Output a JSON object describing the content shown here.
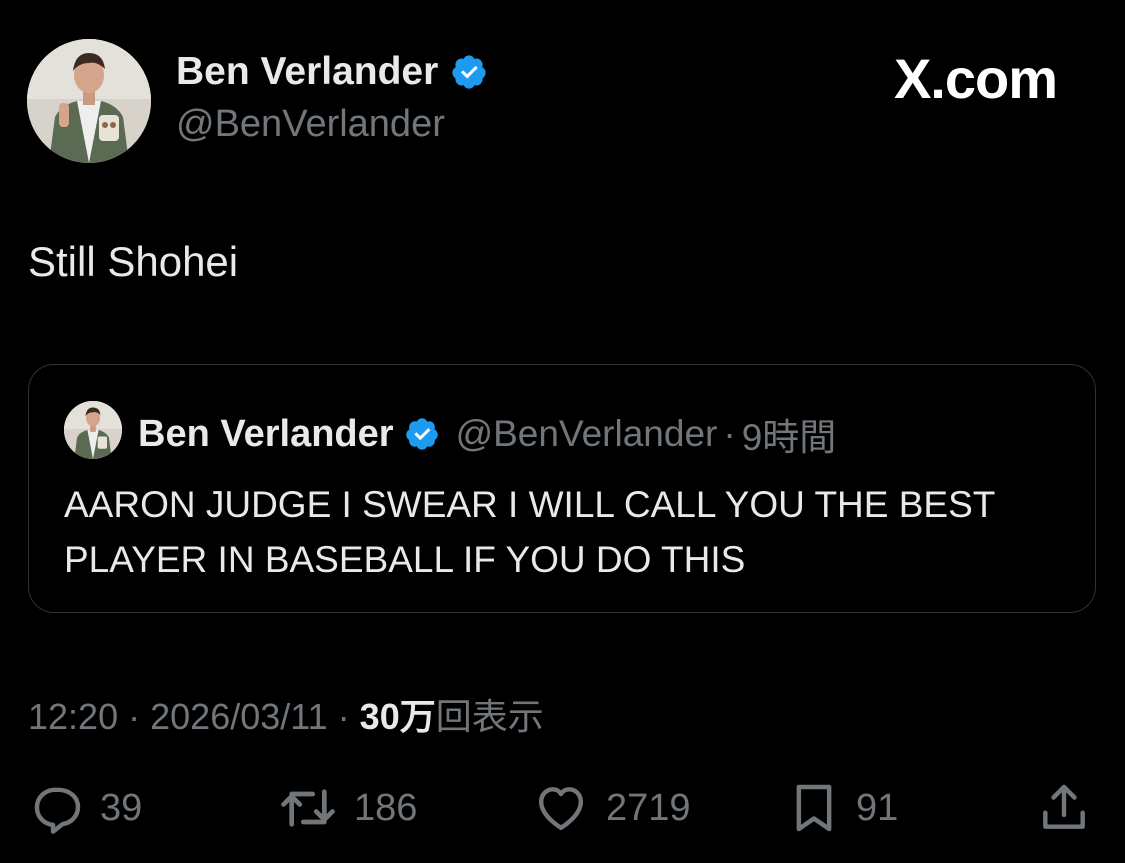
{
  "author": {
    "name": "Ben Verlander",
    "handle": "@BenVerlander",
    "verified": true
  },
  "brand": "X.com",
  "tweet": {
    "text": "Still Shohei"
  },
  "quoted": {
    "name": "Ben Verlander",
    "handle": "@BenVerlander",
    "separator": "·",
    "time": "9時間",
    "text": "AARON JUDGE I SWEAR I WILL CALL YOU THE BEST PLAYER IN BASEBALL IF YOU DO THIS"
  },
  "meta": {
    "time": "12:20",
    "separator": "·",
    "date": "2026/03/11",
    "views_count": "30万",
    "views_label": "回表示"
  },
  "actions": {
    "replies": "39",
    "reposts": "186",
    "likes": "2719",
    "bookmarks": "91"
  },
  "colors": {
    "background": "#000000",
    "text": "#e7e9ea",
    "muted": "#71767b",
    "verified_blue": "#1d9bf0",
    "border": "#2f3336"
  },
  "icons": [
    "verified-badge-icon",
    "reply-icon",
    "repost-icon",
    "like-icon",
    "bookmark-icon",
    "share-icon"
  ]
}
